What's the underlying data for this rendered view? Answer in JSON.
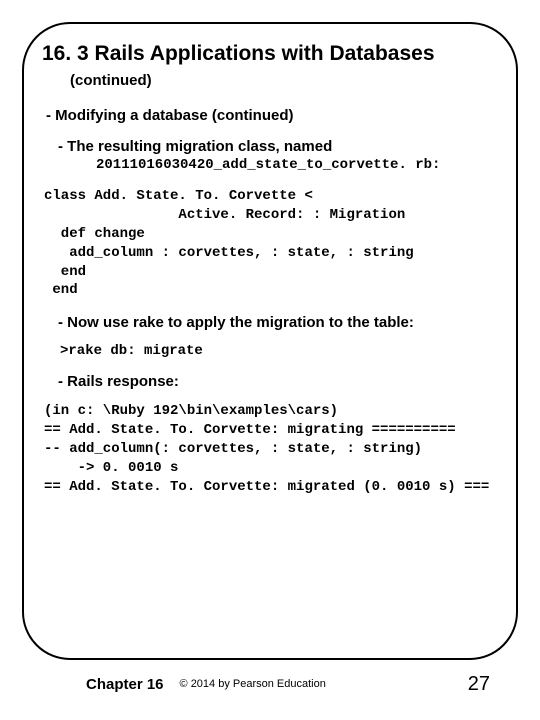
{
  "title": "16. 3 Rails Applications with Databases",
  "subtitle": "(continued)",
  "section_heading": "- Modifying a database (continued)",
  "migration_intro": "- The resulting migration class, named",
  "migration_filename": "20111016030420_add_state_to_corvette. rb:",
  "code_class": "class Add. State. To. Corvette <\n                Active. Record: : Migration\n  def change\n   add_column : corvettes, : state, : string\n  end\n end",
  "rake_intro": "- Now use rake to apply the migration to the table:",
  "rake_cmd": ">rake db: migrate",
  "rails_response_label": "- Rails response:",
  "rails_output": "(in c: \\Ruby 192\\bin\\examples\\cars)\n== Add. State. To. Corvette: migrating ==========\n-- add_column(: corvettes, : state, : string)\n    -> 0. 0010 s\n== Add. State. To. Corvette: migrated (0. 0010 s) ===",
  "footer": {
    "chapter": "Chapter 16",
    "copyright": "© 2014 by Pearson Education",
    "page": "27"
  }
}
